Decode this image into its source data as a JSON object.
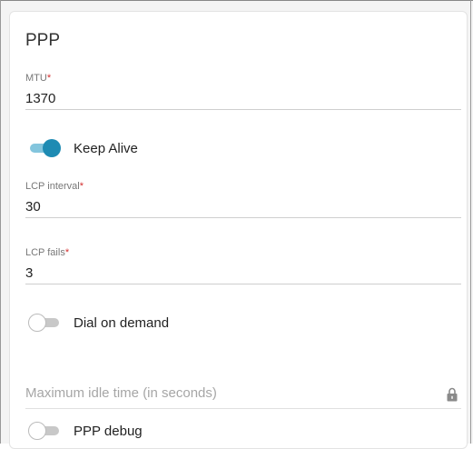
{
  "section": {
    "title": "PPP"
  },
  "fields": {
    "mtu": {
      "label": "MTU",
      "required_mark": "*",
      "value": "1370"
    },
    "lcp_interval": {
      "label": "LCP interval",
      "required_mark": "*",
      "value": "30"
    },
    "lcp_fails": {
      "label": "LCP fails",
      "required_mark": "*",
      "value": "3"
    },
    "max_idle": {
      "placeholder": "Maximum idle time (in seconds)",
      "locked": true,
      "icon": "lock-icon"
    }
  },
  "toggles": {
    "keep_alive": {
      "label": "Keep Alive",
      "on": true
    },
    "dial_on_demand": {
      "label": "Dial on demand",
      "on": false
    },
    "ppp_debug": {
      "label": "PPP debug",
      "on": false
    }
  },
  "colors": {
    "accent": "#1e8bb3",
    "accent_track": "#83c5dd",
    "required": "#d32f2f"
  }
}
